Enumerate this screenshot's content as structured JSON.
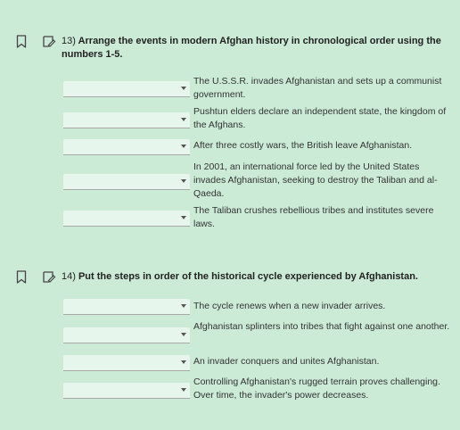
{
  "q13": {
    "number": "13)",
    "prompt": "Arrange the events in modern Afghan history in chronological order using the numbers 1-5.",
    "items": [
      {
        "text": "The U.S.S.R. invades Afghanistan and sets up a communist government.",
        "selected": ""
      },
      {
        "text": "Pushtun elders declare an independent state, the kingdom of the Afghans.",
        "selected": ""
      },
      {
        "text": "After three costly wars, the British leave Afghanistan.",
        "selected": ""
      },
      {
        "text": "In 2001, an international force led by the United States invades Afghanistan, seeking to destroy the Taliban and al-Qaeda.",
        "selected": ""
      },
      {
        "text": "The Taliban crushes rebellious tribes and institutes severe laws.",
        "selected": ""
      }
    ]
  },
  "q14": {
    "number": "14)",
    "prompt": "Put the steps in order of the historical cycle experienced by Afghanistan.",
    "items": [
      {
        "text": "The cycle renews when a new invader arrives.",
        "selected": ""
      },
      {
        "text": "Afghanistan splinters into tribes that fight against one another.",
        "selected": ""
      },
      {
        "text": "An invader conquers and unites Afghanistan.",
        "selected": ""
      },
      {
        "text": "Controlling Afghanistan's rugged terrain proves challenging. Over time, the invader's power decreases.",
        "selected": ""
      }
    ]
  }
}
